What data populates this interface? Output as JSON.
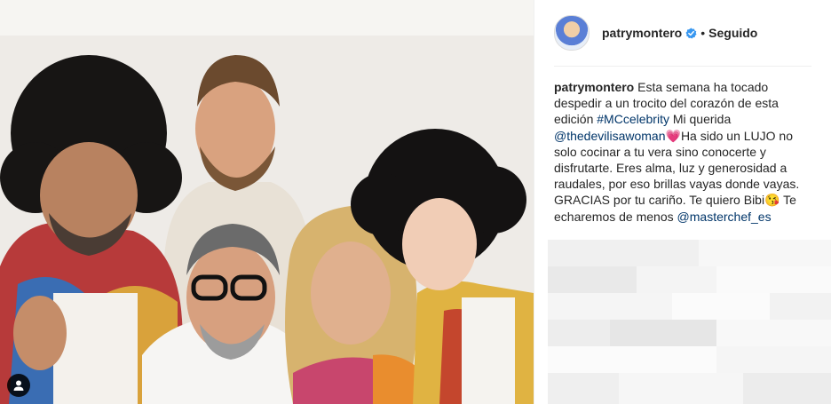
{
  "post": {
    "author": "patrymontero",
    "follow_status": "Seguido",
    "separator": "•",
    "caption": {
      "author": "patrymontero",
      "part1": "Esta semana ha tocado despedir a un trocito del corazón de esta edición",
      "hashtag": "#MCcelebrity",
      "part2": "Mi querida",
      "mention1": "@thedevilisawoman",
      "part3": "Ha sido un LUJO no solo cocinar a tu vera sino conocerte y disfrutarte. Eres alma, luz y generosidad a raudales, por eso brillas vayas donde vayas. GRACIAS por tu cariño. Te quiero Bibi",
      "part4": "Te echaremos de menos",
      "mention2": "@masterchef_es",
      "emoji1": "💗",
      "emoji2": "😘"
    }
  },
  "colors": {
    "link": "#003569",
    "verified": "#3897f0",
    "text": "#262626"
  },
  "icons": {
    "user_tag": "person-tag-icon",
    "verified": "verified-badge-icon"
  }
}
